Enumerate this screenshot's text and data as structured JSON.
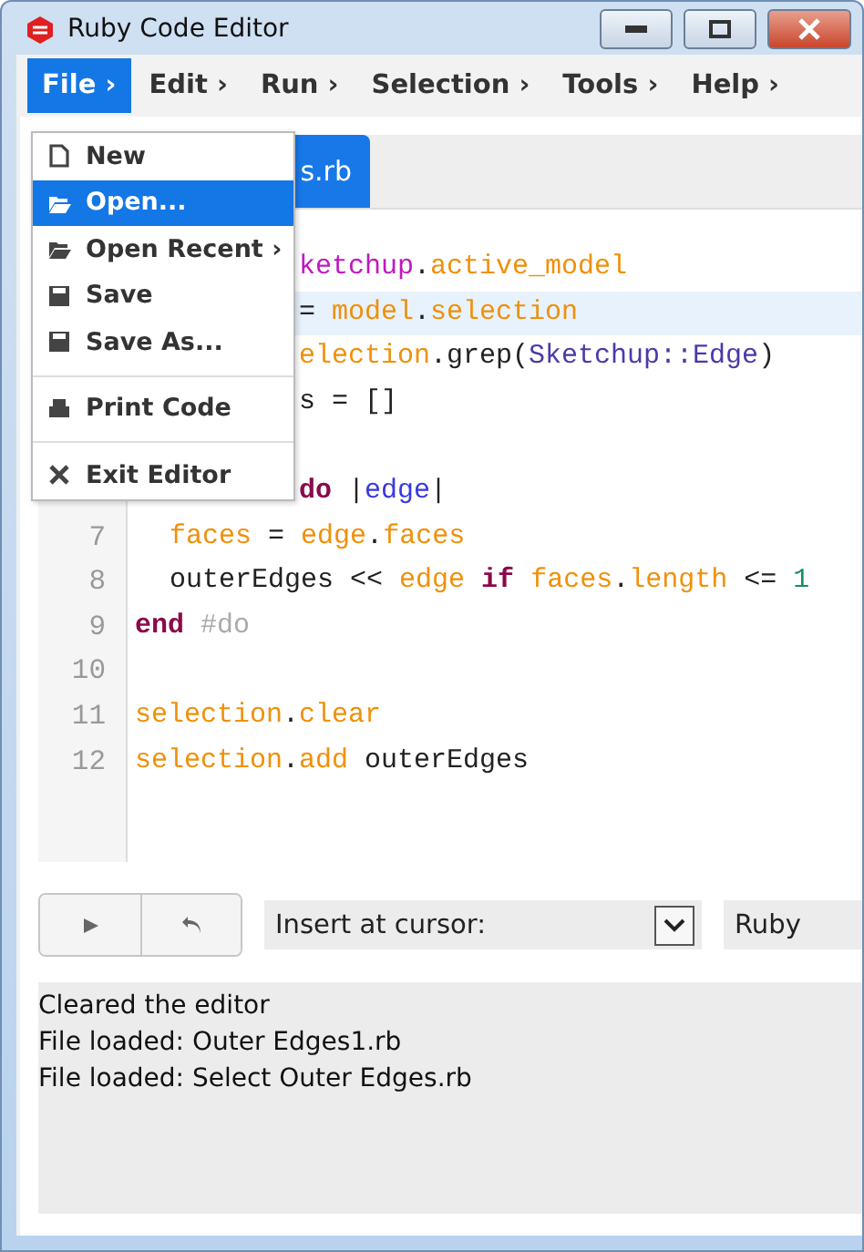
{
  "window": {
    "title": "Ruby Code Editor"
  },
  "menubar": [
    {
      "label": "File ›",
      "selected": true
    },
    {
      "label": "Edit ›",
      "selected": false
    },
    {
      "label": "Run ›",
      "selected": false
    },
    {
      "label": "Selection ›",
      "selected": false
    },
    {
      "label": "Tools ›",
      "selected": false
    },
    {
      "label": "Help ›",
      "selected": false
    }
  ],
  "file_menu": [
    {
      "kind": "new",
      "label": "New",
      "selected": false
    },
    {
      "kind": "open",
      "label": "Open...",
      "selected": true
    },
    {
      "kind": "open",
      "label": "Open Recent ›",
      "selected": false
    },
    {
      "kind": "save",
      "label": "Save",
      "selected": false
    },
    {
      "kind": "save",
      "label": "Save As...",
      "selected": false
    },
    {
      "kind": "separator"
    },
    {
      "kind": "print",
      "label": "Print Code",
      "selected": false
    },
    {
      "kind": "separator"
    },
    {
      "kind": "exit",
      "label": "Exit Editor",
      "selected": false
    }
  ],
  "tabs": [
    {
      "label": "s.rb",
      "selected": true
    }
  ],
  "editor": {
    "lines": [
      {
        "current": false,
        "tokens": [
          {
            "kind": "module",
            "text": "ketchup"
          },
          {
            "kind": "plain",
            "text": "."
          },
          {
            "kind": "var",
            "text": "active_model"
          }
        ]
      },
      {
        "current": true,
        "tokens": [
          {
            "kind": "plain",
            "text": "= "
          },
          {
            "kind": "var",
            "text": "model"
          },
          {
            "kind": "plain",
            "text": "."
          },
          {
            "kind": "var",
            "text": "selection"
          }
        ]
      },
      {
        "current": false,
        "tokens": [
          {
            "kind": "var",
            "text": "election"
          },
          {
            "kind": "plain",
            "text": ".grep("
          },
          {
            "kind": "const",
            "text": "Sketchup::Edge"
          },
          {
            "kind": "plain",
            "text": ")"
          }
        ]
      },
      {
        "current": false,
        "tokens": [
          {
            "kind": "plain",
            "text": "s = []"
          }
        ]
      },
      {
        "current": false
      },
      {
        "current": false,
        "tokens": [
          {
            "kind": "keyword",
            "text": "do"
          },
          {
            "kind": "plain",
            "text": " |"
          },
          {
            "kind": "param",
            "text": "edge"
          },
          {
            "kind": "plain",
            "text": "|"
          }
        ]
      },
      {
        "number": "7",
        "indented": true,
        "current": false,
        "tokens": [
          {
            "kind": "var",
            "text": "faces"
          },
          {
            "kind": "plain",
            "text": " = "
          },
          {
            "kind": "var",
            "text": "edge"
          },
          {
            "kind": "plain",
            "text": "."
          },
          {
            "kind": "var",
            "text": "faces"
          }
        ]
      },
      {
        "number": "8",
        "indented": true,
        "current": false,
        "tokens": [
          {
            "kind": "plain",
            "text": "outerEdges << "
          },
          {
            "kind": "var",
            "text": "edge"
          },
          {
            "kind": "keyword",
            "text": " if "
          },
          {
            "kind": "var",
            "text": "faces"
          },
          {
            "kind": "plain",
            "text": "."
          },
          {
            "kind": "var",
            "text": "length"
          },
          {
            "kind": "plain",
            "text": " <= "
          },
          {
            "kind": "number",
            "text": "1"
          }
        ]
      },
      {
        "number": "9",
        "indented": false,
        "current": false,
        "tokens": [
          {
            "kind": "keyword",
            "text": "end"
          },
          {
            "kind": "comment",
            "text": " #do"
          }
        ]
      },
      {
        "number": "10",
        "current": false
      },
      {
        "number": "11",
        "indented": false,
        "current": false,
        "tokens": [
          {
            "kind": "var",
            "text": "selection"
          },
          {
            "kind": "plain",
            "text": "."
          },
          {
            "kind": "var",
            "text": "clear"
          }
        ]
      },
      {
        "number": "12",
        "indented": false,
        "current": false,
        "tokens": [
          {
            "kind": "var",
            "text": "selection"
          },
          {
            "kind": "plain",
            "text": "."
          },
          {
            "kind": "var",
            "text": "add"
          },
          {
            "kind": "plain",
            "text": " outerEdges"
          }
        ]
      }
    ]
  },
  "toolbar": {
    "insert_select": {
      "value": "Insert at cursor:"
    },
    "language_field": {
      "value": "Ruby"
    }
  },
  "log": [
    "Cleared the editor",
    "File loaded: Outer Edges1.rb",
    "File loaded: Select Outer Edges.rb"
  ]
}
